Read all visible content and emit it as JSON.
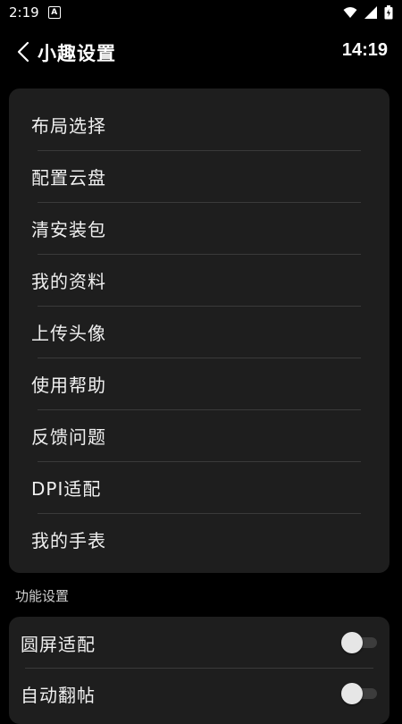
{
  "status_bar": {
    "time": "2:19",
    "notification_icon": "a-icon",
    "icons": [
      "wifi-icon",
      "signal-icon",
      "battery-icon"
    ]
  },
  "header": {
    "back_icon": "chevron-left-icon",
    "title": "小趣设置",
    "time": "14:19"
  },
  "menu": {
    "items": [
      {
        "label": "布局选择"
      },
      {
        "label": "配置云盘"
      },
      {
        "label": "清安装包"
      },
      {
        "label": "我的资料"
      },
      {
        "label": "上传头像"
      },
      {
        "label": "使用帮助"
      },
      {
        "label": "反馈问题"
      },
      {
        "label": "DPI适配"
      },
      {
        "label": "我的手表"
      }
    ]
  },
  "function_settings": {
    "section_title": "功能设置",
    "items": [
      {
        "label": "圆屏适配",
        "enabled": false
      },
      {
        "label": "自动翻帖",
        "enabled": false
      }
    ]
  },
  "colors": {
    "background": "#000000",
    "card": "#1e1e1e",
    "divider": "#3a3a3a",
    "text": "#f0f0f0"
  }
}
